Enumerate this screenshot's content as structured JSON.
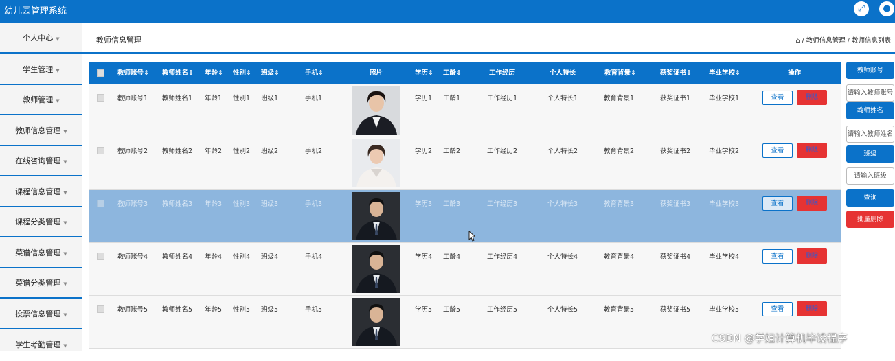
{
  "app": {
    "title": "幼儿园管理系统"
  },
  "sidebar": {
    "items": [
      {
        "label": "个人中心"
      },
      {
        "label": "学生管理"
      },
      {
        "label": "教师管理"
      },
      {
        "label": "教师信息管理"
      },
      {
        "label": "在线咨询管理"
      },
      {
        "label": "课程信息管理"
      },
      {
        "label": "课程分类管理"
      },
      {
        "label": "菜谱信息管理"
      },
      {
        "label": "菜谱分类管理"
      },
      {
        "label": "投票信息管理"
      },
      {
        "label": "学生考勤管理"
      }
    ]
  },
  "page": {
    "title": "教师信息管理",
    "breadcrumb": [
      "教师信息管理",
      "教师信息列表"
    ]
  },
  "table": {
    "columns": [
      "教师账号",
      "教师姓名",
      "年龄",
      "性别",
      "班级",
      "手机",
      "照片",
      "学历",
      "工龄",
      "工作经历",
      "个人特长",
      "教育背景",
      "获奖证书",
      "毕业学校",
      "操作"
    ],
    "rows": [
      [
        "教师账号1",
        "教师姓名1",
        "年龄1",
        "性别1",
        "班级1",
        "手机1",
        "学历1",
        "工龄1",
        "工作经历1",
        "个人特长1",
        "教育背景1",
        "获奖证书1",
        "毕业学校1"
      ],
      [
        "教师账号2",
        "教师姓名2",
        "年龄2",
        "性别2",
        "班级2",
        "手机2",
        "学历2",
        "工龄2",
        "工作经历2",
        "个人特长2",
        "教育背景2",
        "获奖证书2",
        "毕业学校2"
      ],
      [
        "教师账号3",
        "教师姓名3",
        "年龄3",
        "性别3",
        "班级3",
        "手机3",
        "学历3",
        "工龄3",
        "工作经历3",
        "个人特长3",
        "教育背景3",
        "获奖证书3",
        "毕业学校3"
      ],
      [
        "教师账号4",
        "教师姓名4",
        "年龄4",
        "性别4",
        "班级4",
        "手机4",
        "学历4",
        "工龄4",
        "工作经历4",
        "个人特长4",
        "教育背景4",
        "获奖证书4",
        "毕业学校4"
      ],
      [
        "教师账号5",
        "教师姓名5",
        "年龄5",
        "性别5",
        "班级5",
        "手机5",
        "学历5",
        "工龄5",
        "工作经历5",
        "个人特长5",
        "教育背景5",
        "获奖证书5",
        "毕业学校5"
      ]
    ],
    "sort_marker": "⇕",
    "actions": {
      "view": "查看",
      "delete": "删除"
    }
  },
  "search_panel": {
    "account_label": "教师账号",
    "account_placeholder": "请输入教师账号",
    "name_label": "教师姓名",
    "name_placeholder": "请输入教师姓名",
    "class_label": "班级",
    "class_placeholder": "请输入班级",
    "query_button": "查询",
    "batch_delete_button": "批量删除"
  },
  "watermark": "CSDN @学姐计算机毕设程序",
  "colors": {
    "primary": "#0b72c9",
    "danger": "#e63333",
    "selected_row": "#8db6de"
  },
  "icons": {
    "fullscreen": "fullscreen-icon",
    "user": "user-icon",
    "home": "home-icon"
  }
}
